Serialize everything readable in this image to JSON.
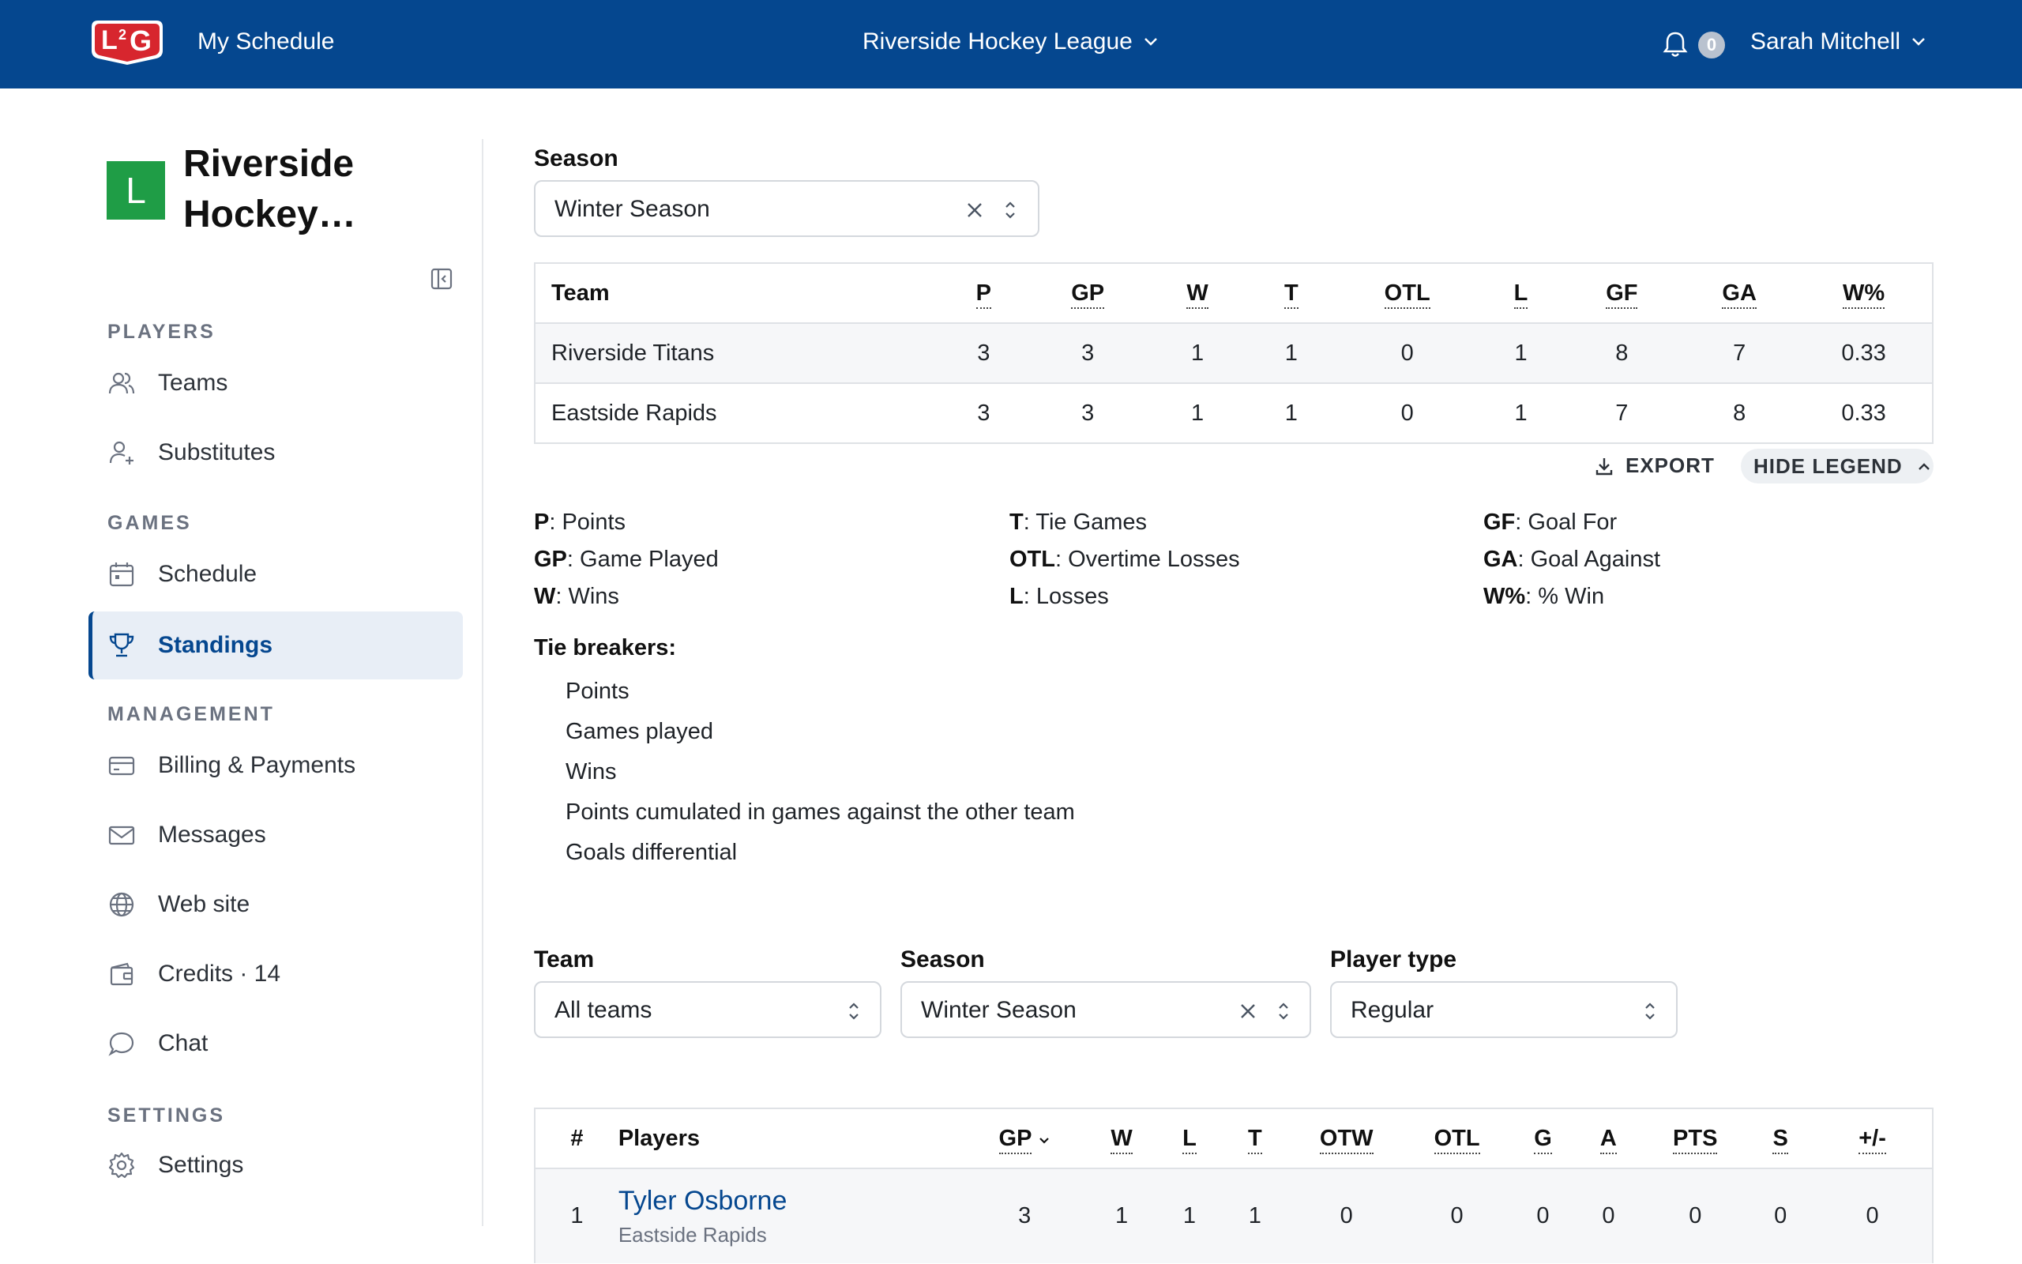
{
  "topbar": {
    "my_schedule": "My Schedule",
    "league": "Riverside Hockey League",
    "notifications": "0",
    "user": "Sarah Mitchell"
  },
  "sidebar": {
    "org_initial": "L",
    "org_name": "Riverside Hockey…",
    "sections": {
      "players": "PLAYERS",
      "games": "GAMES",
      "management": "MANAGEMENT",
      "settings": "SETTINGS"
    },
    "items": {
      "teams": "Teams",
      "substitutes": "Substitutes",
      "schedule": "Schedule",
      "standings": "Standings",
      "billing": "Billing & Payments",
      "messages": "Messages",
      "website": "Web site",
      "credits": "Credits · 14",
      "chat": "Chat",
      "settings": "Settings"
    }
  },
  "standings_filter": {
    "season_label": "Season",
    "season_value": "Winter Season"
  },
  "standings": {
    "headers": [
      "Team",
      "P",
      "GP",
      "W",
      "T",
      "OTL",
      "L",
      "GF",
      "GA",
      "W%"
    ],
    "rows": [
      [
        "Riverside Titans",
        "3",
        "3",
        "1",
        "1",
        "0",
        "1",
        "8",
        "7",
        "0.33"
      ],
      [
        "Eastside Rapids",
        "3",
        "3",
        "1",
        "1",
        "0",
        "1",
        "7",
        "8",
        "0.33"
      ]
    ]
  },
  "actions": {
    "export": "EXPORT",
    "hide_legend": "HIDE LEGEND"
  },
  "legend": [
    [
      [
        "P",
        ": Points"
      ],
      [
        "GP",
        ": Game Played"
      ],
      [
        "W",
        ": Wins"
      ]
    ],
    [
      [
        "T",
        ": Tie Games"
      ],
      [
        "OTL",
        ": Overtime Losses"
      ],
      [
        "L",
        ": Losses"
      ]
    ],
    [
      [
        "GF",
        ": Goal For"
      ],
      [
        "GA",
        ": Goal Against"
      ],
      [
        "W%",
        ": % Win"
      ]
    ]
  ],
  "tie_breakers": {
    "title": "Tie breakers:",
    "items": [
      "Points",
      "Games played",
      "Wins",
      "Points cumulated in games against the other team",
      "Goals differential"
    ]
  },
  "player_filters": {
    "team_label": "Team",
    "team_value": "All teams",
    "season_label": "Season",
    "season_value": "Winter Season",
    "type_label": "Player type",
    "type_value": "Regular"
  },
  "players": {
    "headers": [
      "#",
      "Players",
      "GP",
      "W",
      "L",
      "T",
      "OTW",
      "OTL",
      "G",
      "A",
      "PTS",
      "S",
      "+/-"
    ],
    "rows": [
      {
        "rank": "1",
        "name": "Tyler Osborne",
        "team": "Eastside Rapids",
        "stats": [
          "3",
          "1",
          "1",
          "1",
          "0",
          "0",
          "0",
          "0",
          "0",
          "0",
          "0"
        ]
      }
    ]
  }
}
